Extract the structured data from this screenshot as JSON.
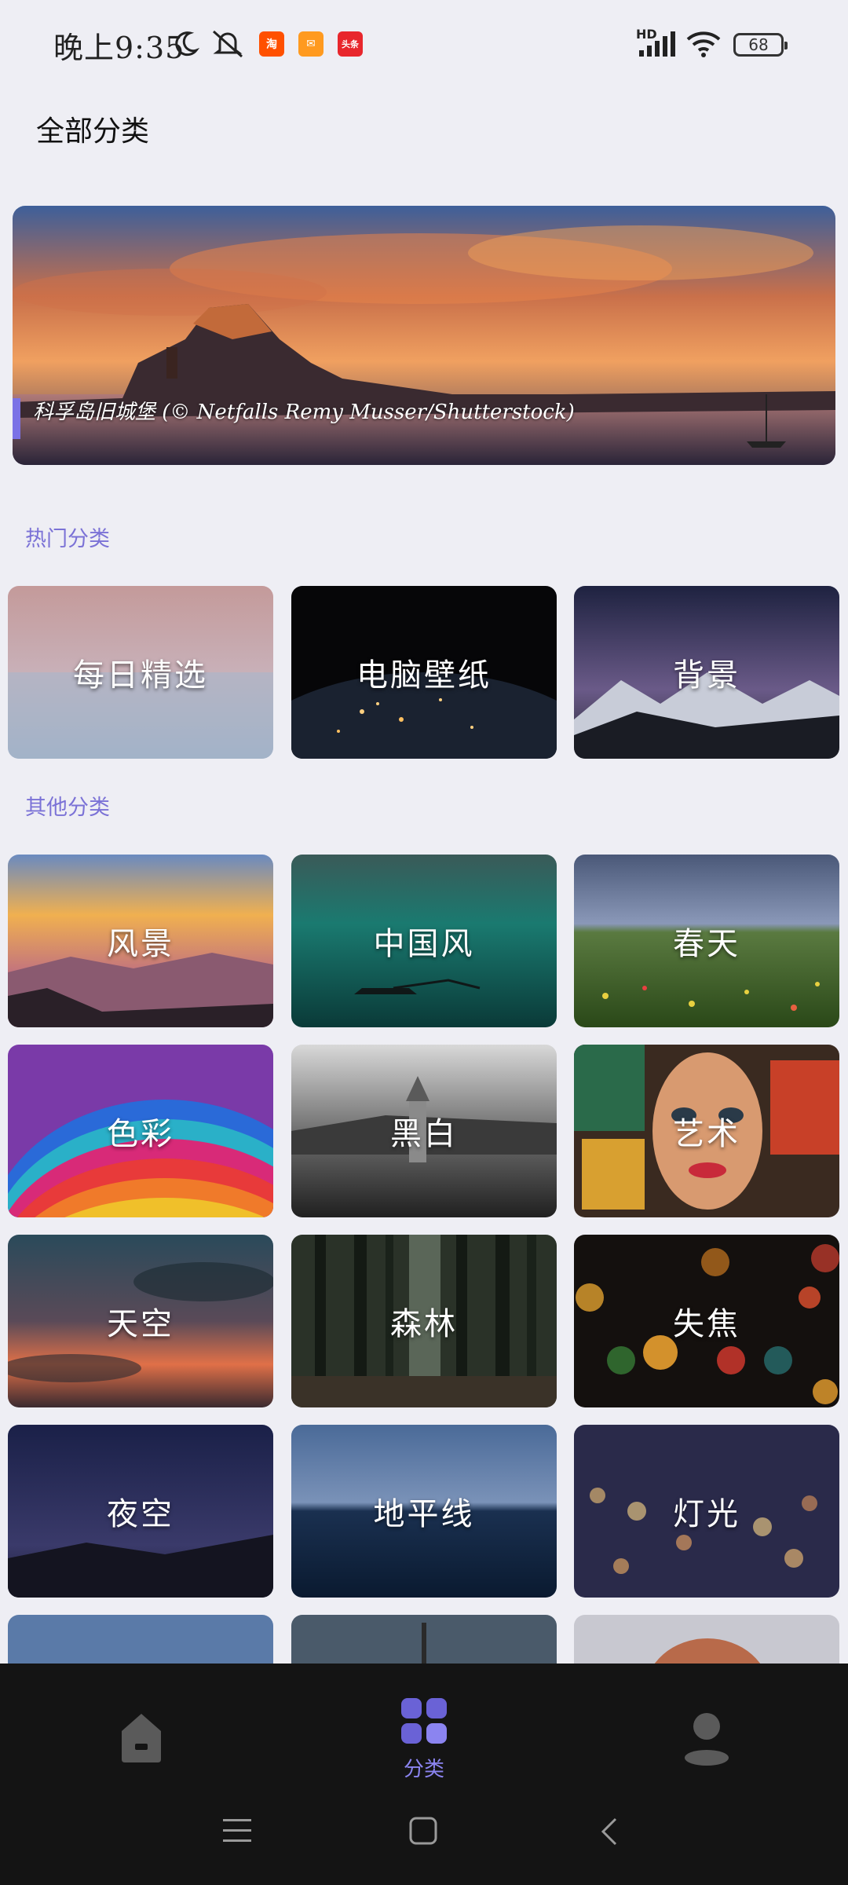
{
  "status_bar": {
    "time": "晚上9:35",
    "battery": "68",
    "network": "HD",
    "app_badges": [
      {
        "name": "taobao",
        "text": "淘",
        "color": "#ff5000"
      },
      {
        "name": "mail",
        "text": "✉",
        "color": "#ff9a1f"
      },
      {
        "name": "news",
        "text": "头条",
        "color": "#e8262c"
      }
    ]
  },
  "header": {
    "title": "全部分类"
  },
  "banner": {
    "caption": "科孚岛旧城堡 (© Netfalls Remy Musser/Shutterstock)"
  },
  "sections": {
    "hot_label": "热门分类",
    "other_label": "其他分类"
  },
  "hot_categories": [
    "每日精选",
    "电脑壁纸",
    "背景"
  ],
  "other_categories": [
    "风景",
    "中国风",
    "春天",
    "色彩",
    "黑白",
    "艺术",
    "天空",
    "森林",
    "失焦",
    "夜空",
    "地平线",
    "灯光"
  ],
  "bottom_nav": {
    "items": [
      {
        "key": "home",
        "label": "",
        "icon": "home-icon"
      },
      {
        "key": "category",
        "label": "分类",
        "icon": "grid-icon",
        "active": true
      },
      {
        "key": "profile",
        "label": "",
        "icon": "user-icon"
      }
    ],
    "accent": "#7b72e6"
  }
}
